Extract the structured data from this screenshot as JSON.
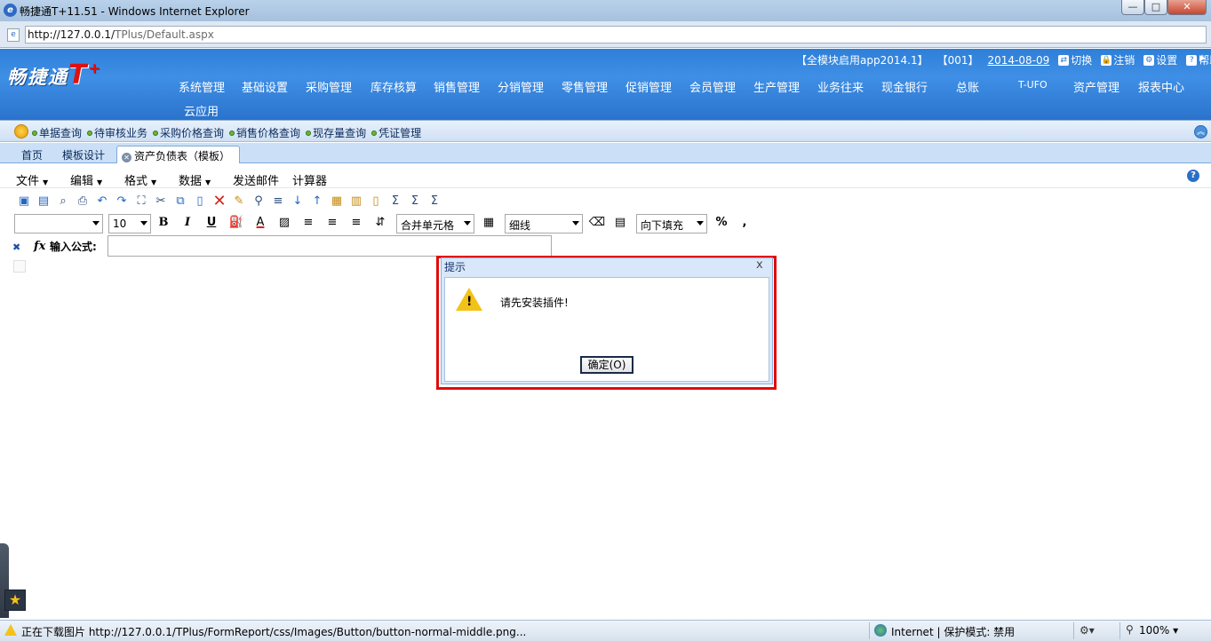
{
  "window": {
    "title": "畅捷通T+11.51 - Windows Internet Explorer",
    "min_label": "—",
    "max_label": "□",
    "close_label": "✕"
  },
  "address": {
    "host": "http://127.0.0.1/",
    "path": "TPlus/Default.aspx"
  },
  "header": {
    "logo_text": "畅捷通",
    "logo_t": "T",
    "logo_plus": "+",
    "module_info": "【全模块启用app2014.1】",
    "account": "【001】",
    "date": "2014-08-09",
    "links": [
      "切换",
      "注销",
      "设置",
      "帮助"
    ],
    "menu": [
      "系统管理",
      "基础设置",
      "采购管理",
      "库存核算",
      "销售管理",
      "分销管理",
      "零售管理",
      "促销管理",
      "会员管理",
      "生产管理",
      "业务往来",
      "现金银行",
      "总账",
      "T-UFO",
      "资产管理",
      "报表中心",
      "云应用"
    ]
  },
  "quick_links": [
    "单据查询",
    "待审核业务",
    "采购价格查询",
    "销售价格查询",
    "现存量查询",
    "凭证管理"
  ],
  "tabs": {
    "home": "首页",
    "template_design": "模板设计",
    "active": "资产负债表（模板）"
  },
  "menubar": {
    "file": "文件",
    "edit": "编辑",
    "format": "格式",
    "data": "数据",
    "send_mail": "发送邮件",
    "calculator": "计算器"
  },
  "toolbar2": {
    "font_name": "",
    "font_size": "10",
    "merge": "合并单元格",
    "border": "细线",
    "fill": "向下填充",
    "bold": "B",
    "italic": "I",
    "underline": "U",
    "font_color": "A",
    "percent": "%",
    "comma": ","
  },
  "formula": {
    "label": "输入公式:",
    "value": "",
    "fx": "fx"
  },
  "dialog": {
    "title": "提示",
    "close": "x",
    "message": "请先安装插件!",
    "ok": "确定(O)"
  },
  "status": {
    "text": "正在下载图片 http://127.0.0.1/TPlus/FormReport/css/Images/Button/button-normal-middle.png...",
    "zone": "Internet | 保护模式: 禁用",
    "zoom": "100%"
  },
  "colors": {
    "header_blue": "#2e7fd8",
    "dialog_highlight": "#e00c0c",
    "warning_yellow": "#f3c218"
  }
}
